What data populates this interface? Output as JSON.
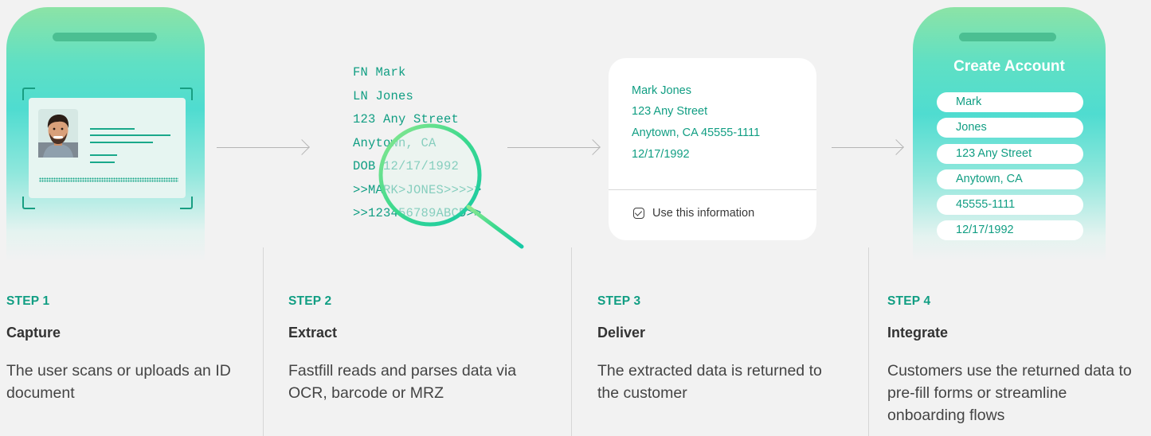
{
  "step2_text": {
    "lines": [
      "FN Mark",
      "LN Jones",
      "123 Any Street",
      "Anytown, CA",
      "DOB 12/17/1992",
      ">>MARK>JONES>>>>>",
      ">>123456789ABCD>>"
    ]
  },
  "step3_card": {
    "lines": [
      "Mark Jones",
      "123 Any Street",
      "Anytown, CA 45555-1111",
      "12/17/1992"
    ],
    "confirm_label": "Use this information"
  },
  "step4_phone": {
    "title": "Create Account",
    "fields": [
      "Mark",
      "Jones",
      "123 Any Street",
      "Anytown, CA",
      "45555-1111",
      "12/17/1992"
    ]
  },
  "steps": [
    {
      "label": "STEP 1",
      "title": "Capture",
      "description": "The user scans or uploads an ID document"
    },
    {
      "label": "STEP 2",
      "title": "Extract",
      "description": "Fastfill reads and parses data via OCR, barcode or MRZ"
    },
    {
      "label": "STEP 3",
      "title": "Deliver",
      "description": "The extracted data is returned to the customer"
    },
    {
      "label": "STEP 4",
      "title": "Integrate",
      "description": "Customers use the returned data to pre-fill forms or streamline onboarding flows"
    }
  ],
  "colors": {
    "accent": "#119e83",
    "background": "#f2f2f2",
    "phone_gradient_top": "#8ce3a6",
    "phone_gradient_mid": "#4fdcd0"
  },
  "icons": [
    "magnifier-icon",
    "checkbox-icon",
    "arrow-right-icon"
  ]
}
